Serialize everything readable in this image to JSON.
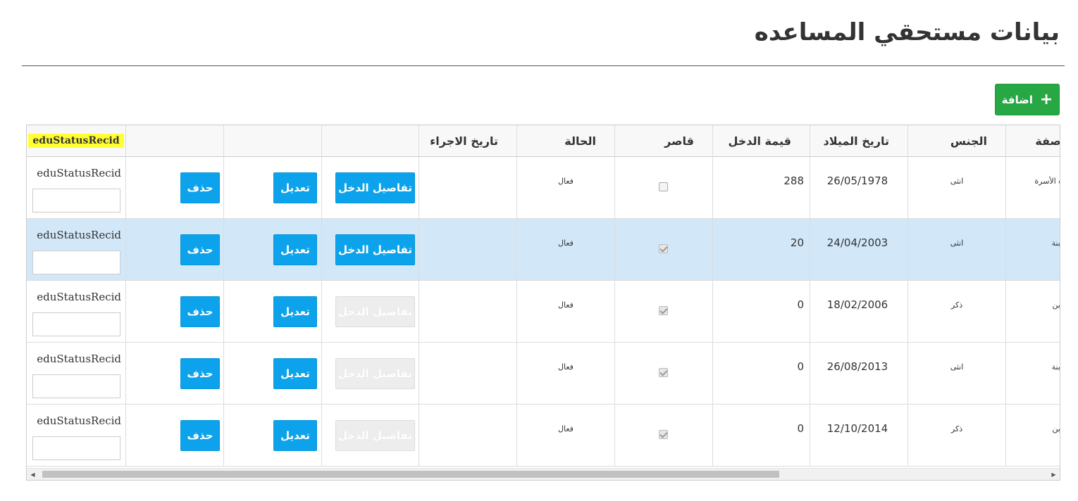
{
  "page": {
    "title": "بيانات مستحقي المساعده",
    "add_button": {
      "label": "اضافة",
      "icon": "plus-icon",
      "color": "#28a745"
    }
  },
  "grid": {
    "headers": {
      "edu_status": "eduStatusRecid",
      "procedure_date": "تاريخ الاجراء",
      "status": "الحالة",
      "minor": "قاصر",
      "income_value": "قيمة الدخل",
      "birth_date": "تاريخ الميلاد",
      "gender": "الجنس",
      "relation": "صفة"
    },
    "button_labels": {
      "delete": "حذف",
      "edit": "تعديل",
      "income_details": "تفاصيل الدخل"
    },
    "edu_label": "eduStatusRecid",
    "rows": [
      {
        "relation": "ه الأسرة",
        "gender": "انثى",
        "birth_date": "26/05/1978",
        "income_value": "288",
        "minor": false,
        "status": "فعال",
        "procedure_date": "",
        "income_details_enabled": true,
        "selected": false
      },
      {
        "relation": "ابنة",
        "gender": "انثى",
        "birth_date": "24/04/2003",
        "income_value": "20",
        "minor": true,
        "status": "فعال",
        "procedure_date": "",
        "income_details_enabled": true,
        "selected": true
      },
      {
        "relation": "ابن",
        "gender": "ذكر",
        "birth_date": "18/02/2006",
        "income_value": "0",
        "minor": true,
        "status": "فعال",
        "procedure_date": "",
        "income_details_enabled": false,
        "selected": false
      },
      {
        "relation": "ابنة",
        "gender": "انثى",
        "birth_date": "26/08/2013",
        "income_value": "0",
        "minor": true,
        "status": "فعال",
        "procedure_date": "",
        "income_details_enabled": false,
        "selected": false
      },
      {
        "relation": "ابن",
        "gender": "ذكر",
        "birth_date": "12/10/2014",
        "income_value": "0",
        "minor": true,
        "status": "فعال",
        "procedure_date": "",
        "income_details_enabled": false,
        "selected": false
      }
    ],
    "colors": {
      "primary_button": "#0ca3ec",
      "selected_row": "#d2e7f8",
      "highlight": "#ffff33"
    }
  }
}
